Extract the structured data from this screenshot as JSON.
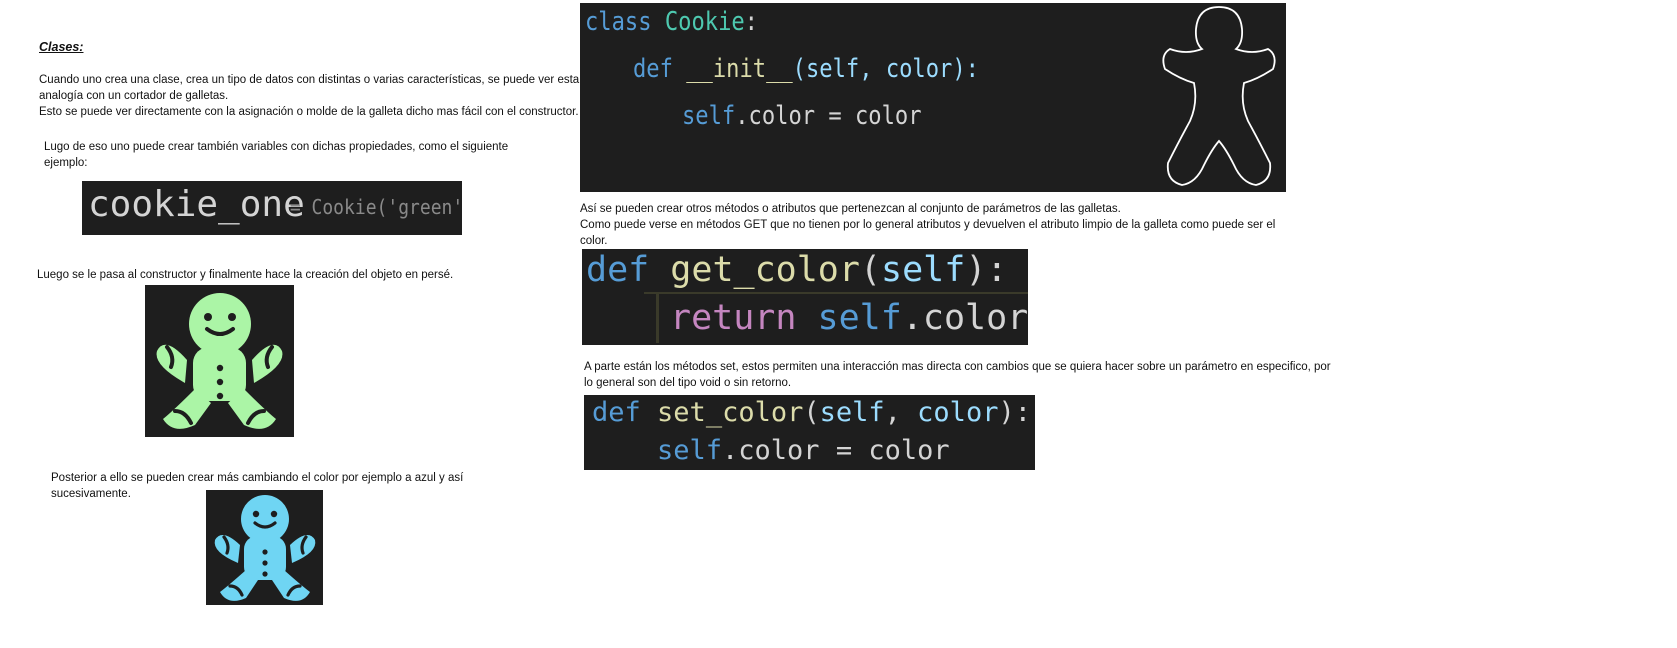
{
  "left": {
    "heading": "Clases:",
    "p1": "Cuando uno crea una clase, crea un tipo de datos con distintas o varias características, se puede ver esta",
    "p2": "analogía con un cortador de galletas.",
    "p3": "Esto se puede ver directamente con la asignación o molde de la galleta dicho mas fácil con el constructor.",
    "p4": "Lugo de eso uno puede crear también variables con dichas propiedades, como el siguiente",
    "p5": "ejemplo:",
    "code_example": {
      "var": "cookie_one",
      "rest": " = Cookie('green')"
    },
    "p6": "Luego se le pasa al constructor y finalmente hace la creación del objeto en persé.",
    "p7": "Posterior a ello se pueden crear más cambiando el color por ejemplo a azul y así",
    "p8": "sucesivamente."
  },
  "right": {
    "class_code": {
      "kw_class": "class",
      "class_name": "Cookie",
      "colon1": ":",
      "kw_def": "def",
      "init_name": "__init__",
      "params": "(self, color):",
      "self_kw": "self",
      "assign": ".color = color"
    },
    "p1": "Así se pueden crear otros métodos o atributos que pertenezcan al conjunto de parámetros de las galletas.",
    "p2": "Como puede verse en métodos GET que no tienen por lo general atributos y devuelven el atributo limpio de la galleta como puede ser el",
    "p3": "color.",
    "get_code": {
      "kw_def": "def",
      "fn": "get_color",
      "paren_open": "(",
      "self_kw": "self",
      "paren_close": "):",
      "kw_return": "return",
      "self_kw2": "self",
      "attr": ".color"
    },
    "p4": "A parte están los métodos set, estos permiten una interacción mas directa con cambios que se quiera hacer sobre un parámetro en especifico, por",
    "p5": "lo general son del tipo void o sin retorno.",
    "set_code": {
      "kw_def": "def",
      "fn": "set_color",
      "paren_open": "(",
      "self_kw": "self",
      "comma": ", ",
      "param": "color",
      "paren_close": "):",
      "self_kw2": "self",
      "assign": ".color = color"
    }
  },
  "colors": {
    "code_bg": "#1e1e1e",
    "keyword_blue": "#569cd6",
    "class_teal": "#4ec9b0",
    "func_yellow": "#dcdcaa",
    "var_lightblue": "#9cdcfe",
    "return_pink": "#c586c0",
    "green_cookie": "#abf5a6",
    "blue_cookie": "#6fd5f3"
  },
  "icons": [
    "gingerbread-outline-icon",
    "green-gingerbread-icon",
    "blue-gingerbread-icon"
  ]
}
